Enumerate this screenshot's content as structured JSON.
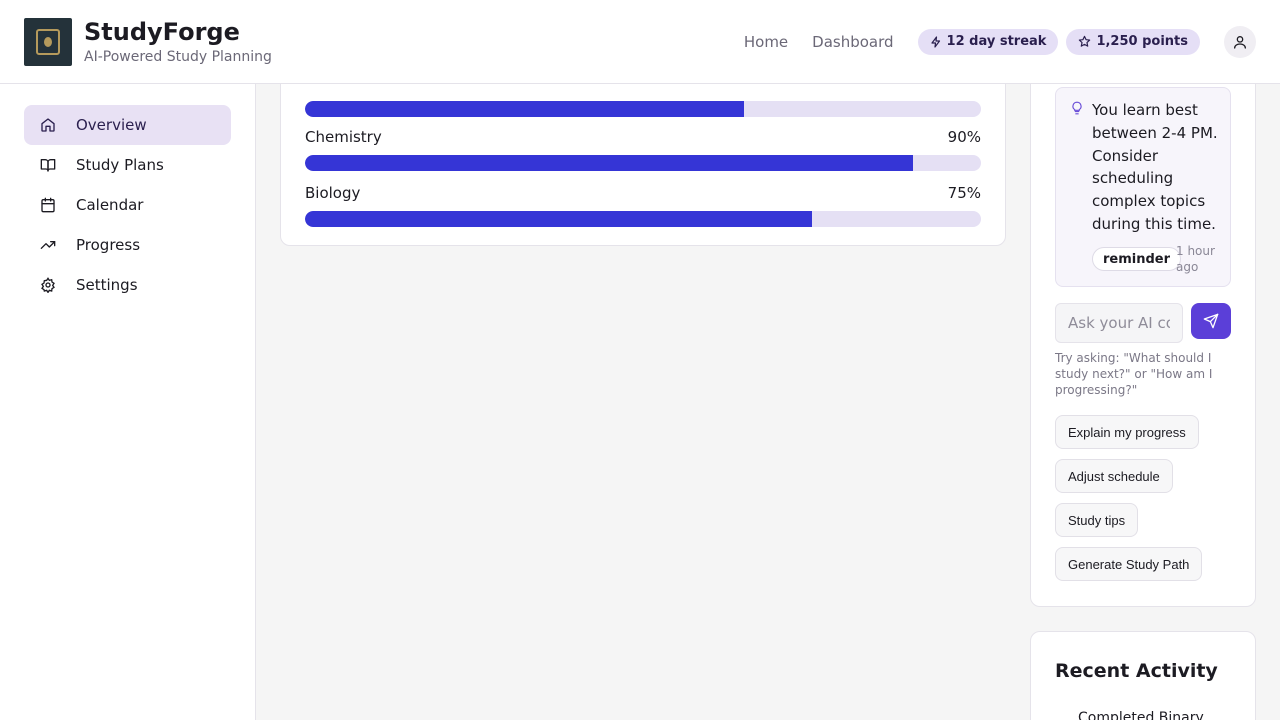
{
  "header": {
    "app_title": "StudyForge",
    "app_subtitle": "AI-Powered Study Planning",
    "nav": [
      "Home",
      "Dashboard"
    ],
    "streak": "12 day streak",
    "points": "1,250 points"
  },
  "sidebar": {
    "items": [
      {
        "label": "Overview",
        "icon": "home-icon",
        "active": true
      },
      {
        "label": "Study Plans",
        "icon": "book-icon"
      },
      {
        "label": "Calendar",
        "icon": "calendar-icon"
      },
      {
        "label": "Progress",
        "icon": "trending-up-icon"
      },
      {
        "label": "Settings",
        "icon": "gear-icon"
      }
    ]
  },
  "subjects": [
    {
      "name": "",
      "percent_label": "",
      "value": 0.65
    },
    {
      "name": "Chemistry",
      "percent_label": "90%",
      "value": 0.9
    },
    {
      "name": "Biology",
      "percent_label": "75%",
      "value": 0.75
    }
  ],
  "coach": {
    "tip_text": "You learn best between 2-4 PM. Consider scheduling complex topics during this time.",
    "tip_tag": "reminder",
    "tip_time": "1 hour ago",
    "input_placeholder": "Ask your AI coach...",
    "hint": "Try asking: \"What should I study next?\" or \"How am I progressing?\"",
    "suggestions": [
      "Explain my progress",
      "Adjust schedule",
      "Study tips",
      "Generate Study Path"
    ]
  },
  "activity": {
    "title": "Recent Activity",
    "first_item": "Completed Binary"
  },
  "colors": {
    "accent": "#3535d6",
    "send_button": "#5b3fd8",
    "active_nav": "#e8e1f4",
    "badge": "#e5dff6"
  }
}
